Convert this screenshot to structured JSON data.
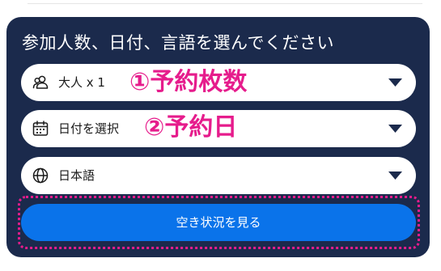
{
  "panel": {
    "title": "参加人数、日付、言語を選んでください",
    "participants_field": {
      "value": "大人 x 1",
      "icon": "users-icon",
      "annotation": "①予約枚数"
    },
    "date_field": {
      "value": "日付を選択",
      "icon": "calendar-icon",
      "annotation": "②予約日"
    },
    "language_field": {
      "value": "日本語",
      "icon": "globe-icon"
    },
    "availability_button": {
      "label": "空き状況を見る"
    }
  },
  "colors": {
    "panel_background": "#1b2a4c",
    "primary_button": "#0a73ea",
    "annotation": "#e61c8c"
  }
}
